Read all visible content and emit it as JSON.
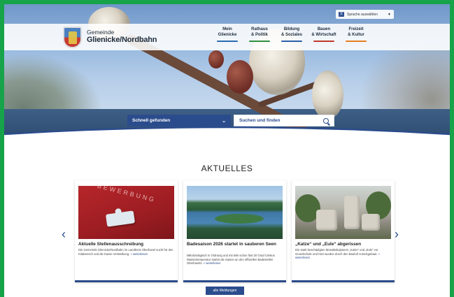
{
  "header": {
    "language_label": "Sprache auswählen",
    "brand_small": "Gemeinde",
    "brand_large": "Glienicke/Nordbahn"
  },
  "nav": {
    "items": [
      {
        "line1": "Mein",
        "line2": "Glienicke",
        "color": "#2b6cb0"
      },
      {
        "line1": "Rathaus",
        "line2": "& Politik",
        "color": "#2f8f3f"
      },
      {
        "line1": "Bildung",
        "line2": "& Soziales",
        "color": "#2b5fa8"
      },
      {
        "line1": "Bauen",
        "line2": "& Wirtschaft",
        "color": "#c0392b"
      },
      {
        "line1": "Freizeit",
        "line2": "& Kultur",
        "color": "#e67e22"
      }
    ]
  },
  "search": {
    "quick_label": "Schnell gefunden",
    "find_label": "Suchen und finden"
  },
  "news": {
    "section_title": "AKTUELLES",
    "cards": [
      {
        "title": "Aktuelle Stellenausschreibung",
        "text": "Die Gemeinde Glienicke/Nordbahn im Landkreis Oberhavel sucht für den Kitabereich und die Kasse Verstärkung.",
        "more": "weiterlesen",
        "image_word": "BEWERBUNG"
      },
      {
        "title": "Badesaison 2026 startet in sauberen Seen",
        "text": "Mikrobiologisch in Ordnung und mit teils schon fast 20 Grad Celsius Wassertemperatur startet die Saison an den offiziellen Badestellen Oberhavels.",
        "more": "weiterlesen"
      },
      {
        "title": "„Katze“ und „Eule“ abgerissen",
        "text": "Die stark beschädigten Mosaikskulpturen „Katze“ und „Eule“ vor Grundschule und Hort wurden durch den Bauhof zurückgebaut.",
        "more": "weiterlesen"
      }
    ],
    "all_button": "alle Meldungen"
  },
  "colors": {
    "accent": "#2b4c8c",
    "frame": "#17a34a"
  }
}
